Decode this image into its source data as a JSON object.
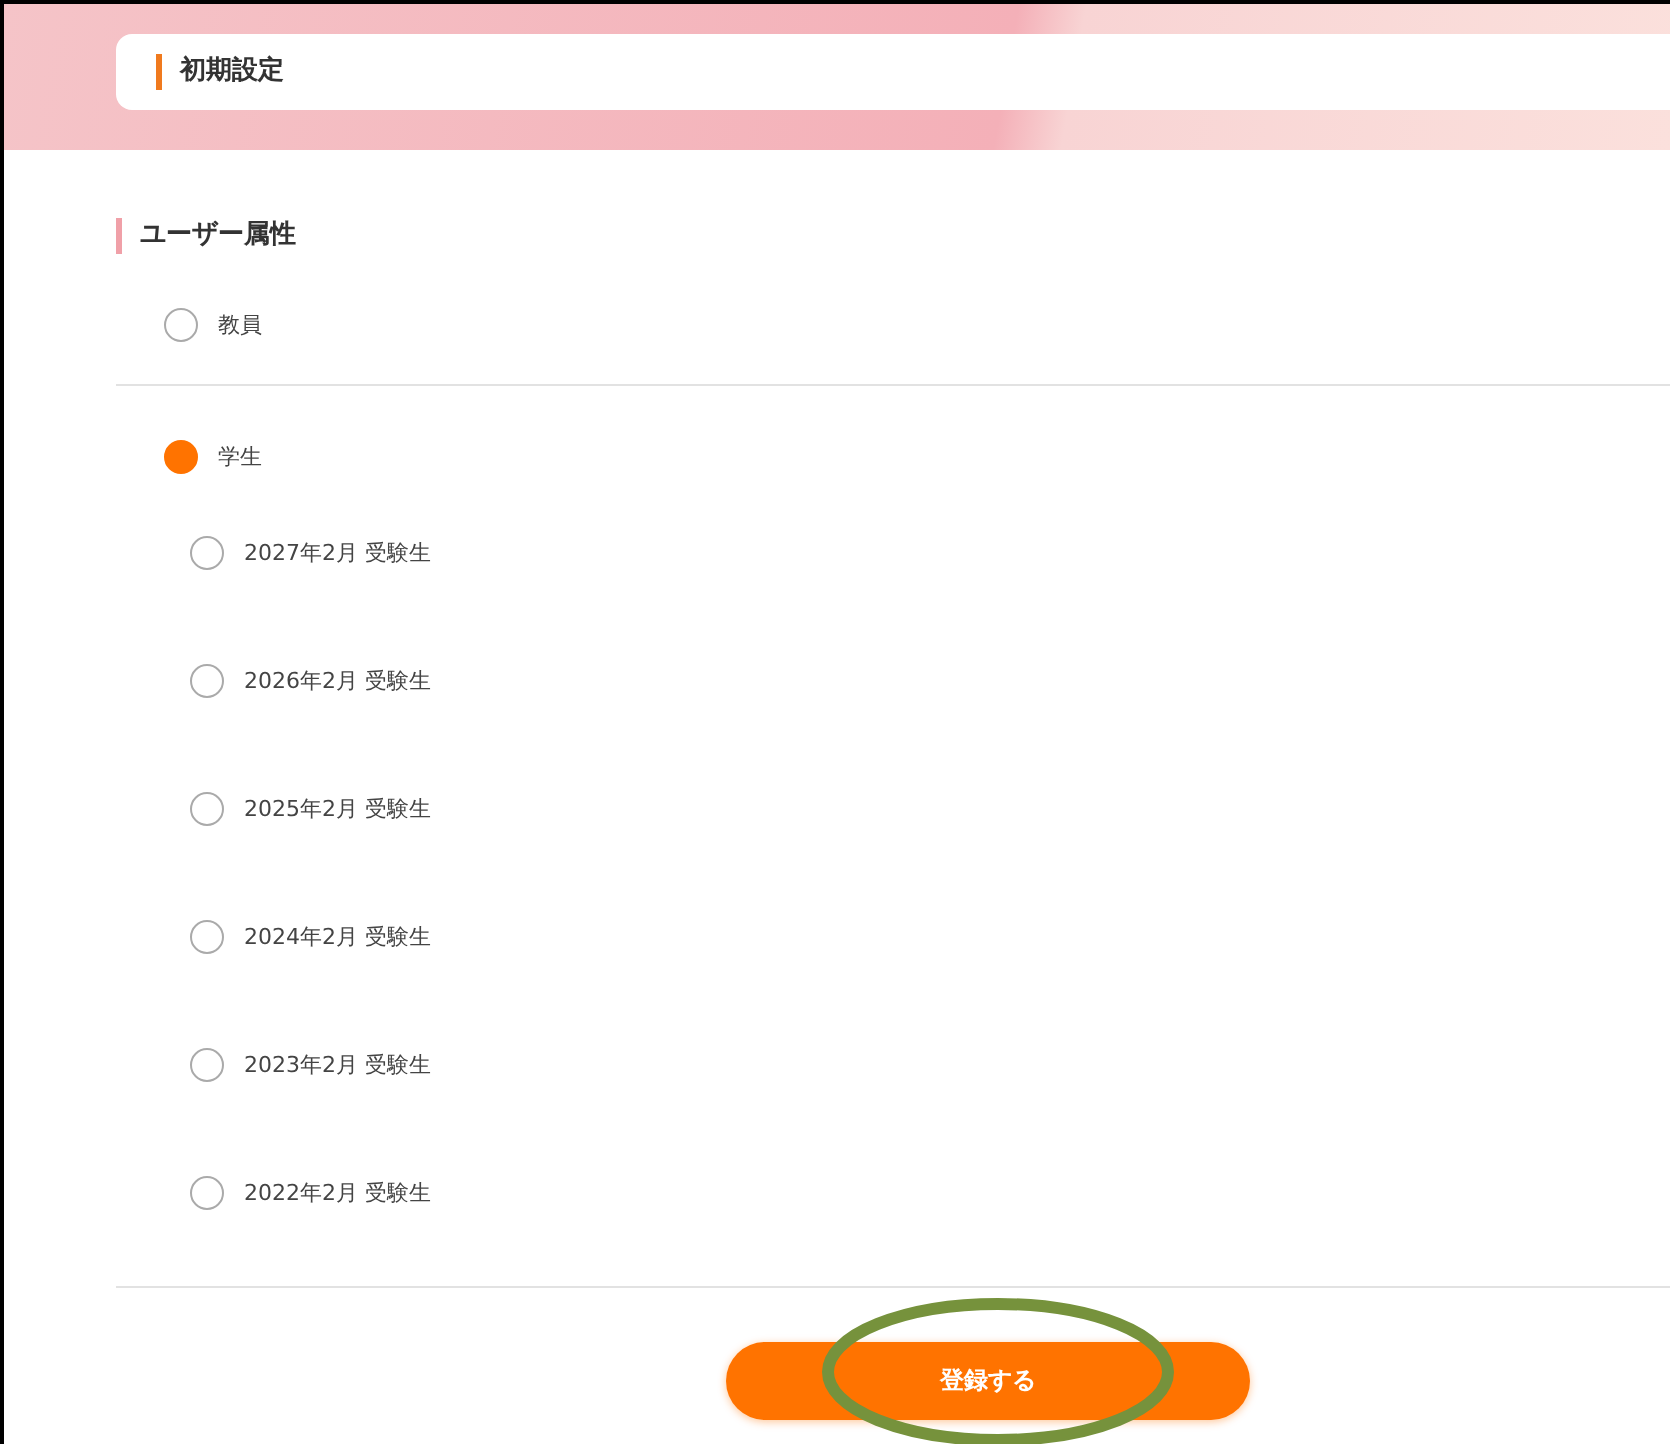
{
  "header": {
    "title": "初期設定"
  },
  "section": {
    "title": "ユーザー属性"
  },
  "options": [
    {
      "label": "教員",
      "selected": false
    },
    {
      "label": "学生",
      "selected": true,
      "children": [
        {
          "label": "2027年2月 受験生",
          "selected": false
        },
        {
          "label": "2026年2月 受験生",
          "selected": false
        },
        {
          "label": "2025年2月 受験生",
          "selected": false
        },
        {
          "label": "2024年2月 受験生",
          "selected": false
        },
        {
          "label": "2023年2月 受験生",
          "selected": false
        },
        {
          "label": "2022年2月 受験生",
          "selected": false
        }
      ]
    }
  ],
  "submit_button": {
    "label": "登録する"
  }
}
